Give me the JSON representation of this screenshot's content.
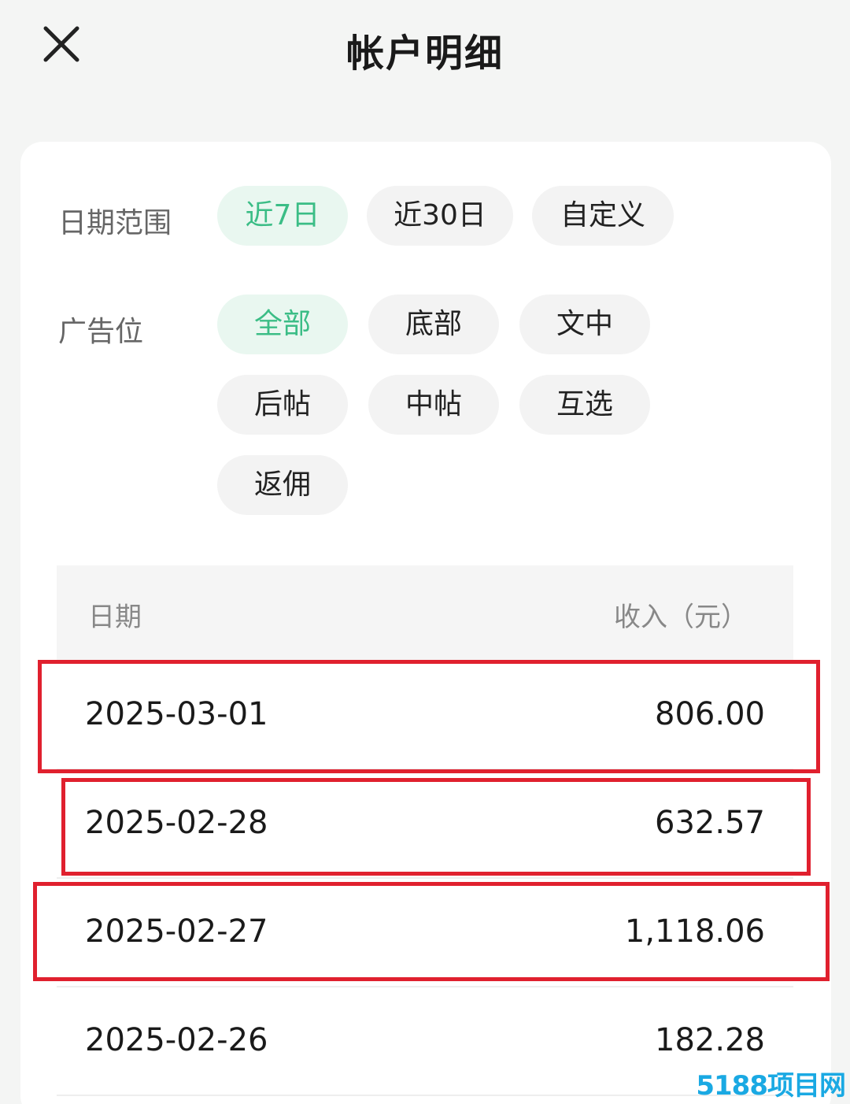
{
  "header": {
    "title": "帐户明细",
    "close_icon": "close-icon"
  },
  "filters": {
    "date_range": {
      "label": "日期范围",
      "options": [
        "近7日",
        "近30日",
        "自定义"
      ],
      "selected": "近7日"
    },
    "ad_slot": {
      "label": "广告位",
      "options": [
        "全部",
        "底部",
        "文中",
        "后帖",
        "中帖",
        "互选",
        "返佣"
      ],
      "selected": "全部"
    }
  },
  "table": {
    "headers": {
      "date": "日期",
      "income": "收入（元）"
    },
    "rows": [
      {
        "date": "2025-03-01",
        "amount": "806.00",
        "highlighted": true
      },
      {
        "date": "2025-02-28",
        "amount": "632.57",
        "highlighted": true
      },
      {
        "date": "2025-02-27",
        "amount": "1,118.06",
        "highlighted": true
      },
      {
        "date": "2025-02-26",
        "amount": "182.28",
        "highlighted": false
      }
    ]
  },
  "watermark": "5188项目网",
  "colors": {
    "accent_green": "#3bbd86",
    "active_chip_bg": "#e9f7f0",
    "highlight_red": "#e0202e"
  }
}
